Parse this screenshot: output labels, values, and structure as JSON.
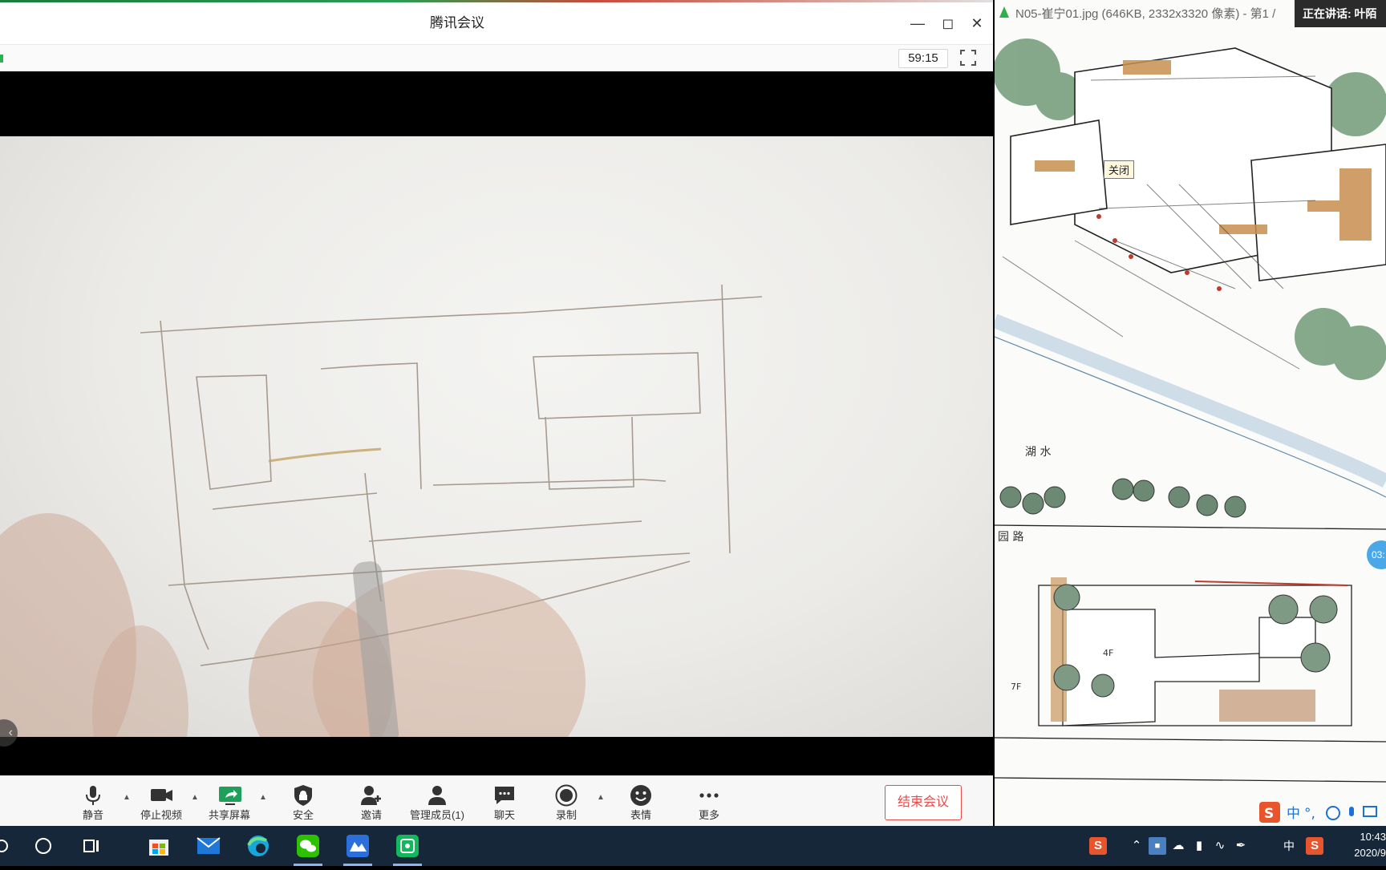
{
  "meeting": {
    "title": "腾讯会议",
    "timer": "59:15",
    "window_controls": [
      "minimize-icon",
      "maximize-icon",
      "close-icon"
    ],
    "toolbar": {
      "mute": "静音",
      "stop_video": "停止视频",
      "share_screen": "共享屏幕",
      "security": "安全",
      "invite": "邀请",
      "manage_members": "管理成员(1)",
      "chat": "聊天",
      "record": "录制",
      "emoji": "表情",
      "more": "更多",
      "end_meeting": "结束会议"
    },
    "accent_color": "#e94a4a"
  },
  "viewer": {
    "file_title": "N05-崔宁01.jpg (646KB, 2332x3320 像素) - 第1 /",
    "speaking": "正在讲话: 叶陌",
    "close_tooltip": "关闭",
    "time_bubble": "03:",
    "drawing_labels": {
      "lake": "湖 水",
      "road": "园 路",
      "floor_4f": "4F",
      "floor_7f": "7F"
    }
  },
  "taskbar": {
    "time": "10:43",
    "date": "2020/9",
    "ime": "中",
    "apps": [
      "store-icon",
      "mail-icon",
      "edge-icon",
      "wechat-icon",
      "meeting-icon",
      "tencent-meeting-icon"
    ]
  }
}
